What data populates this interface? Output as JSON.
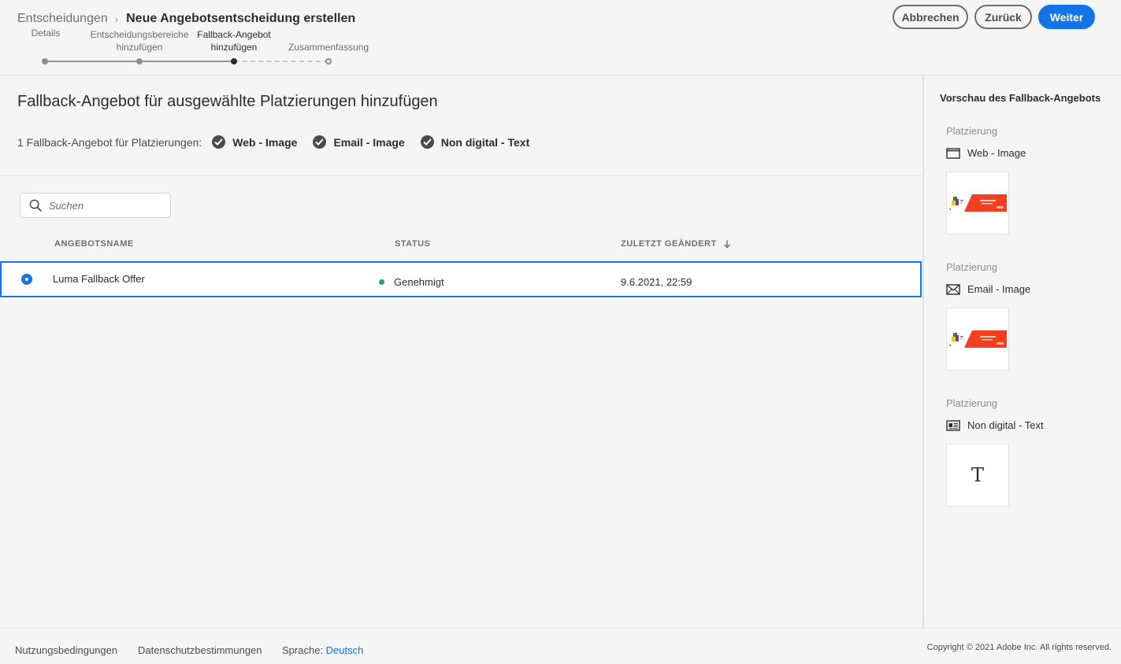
{
  "header": {
    "breadcrumb_parent": "Entscheidungen",
    "breadcrumb_current": "Neue Angebotsentscheidung erstellen",
    "buttons": {
      "cancel": "Abbrechen",
      "back": "Zurück",
      "next": "Weiter"
    },
    "steps": [
      {
        "line1": "",
        "line2": "Details",
        "state": "done"
      },
      {
        "line1": "Entscheidungsbereiche",
        "line2": "hinzufügen",
        "state": "done"
      },
      {
        "line1": "Fallback-Angebot",
        "line2": "hinzufügen",
        "state": "current"
      },
      {
        "line1": "",
        "line2": "Zusammenfassung",
        "state": "future"
      }
    ]
  },
  "main": {
    "title": "Fallback-Angebot für ausgewählte Platzierungen hinzufügen",
    "placements_label": "1 Fallback-Angebot für Platzierungen:",
    "placements": [
      "Web - Image",
      "Email - Image",
      "Non digital - Text"
    ],
    "search_placeholder": "Suchen",
    "table": {
      "columns": [
        "ANGEBOTSNAME",
        "STATUS",
        "ZULETZT GEÄNDERT"
      ],
      "rows": [
        {
          "name": "Luma Fallback Offer",
          "status": "Genehmigt",
          "modified": "9.6.2021, 22:59",
          "selected": true
        }
      ]
    }
  },
  "preview": {
    "title": "Vorschau des Fallback-Angebots",
    "items": [
      {
        "label": "Platzierung",
        "name": "Web - Image",
        "icon": "browser-window-icon",
        "type": "image"
      },
      {
        "label": "Platzierung",
        "name": "Email - Image",
        "icon": "envelope-icon",
        "type": "image"
      },
      {
        "label": "Platzierung",
        "name": "Non digital - Text",
        "icon": "newspaper-icon",
        "type": "text",
        "glyph": "T"
      }
    ]
  },
  "footer": {
    "terms": "Nutzungsbedingungen",
    "privacy": "Datenschutzbestimmungen",
    "language_label": "Sprache:",
    "language_value": "Deutsch",
    "copyright": "Copyright ©  2021 Adobe Inc.  All rights reserved."
  },
  "colors": {
    "accent": "#1473e6",
    "status_approved": "#2d9d78",
    "banner_red": "#f33f1f"
  }
}
